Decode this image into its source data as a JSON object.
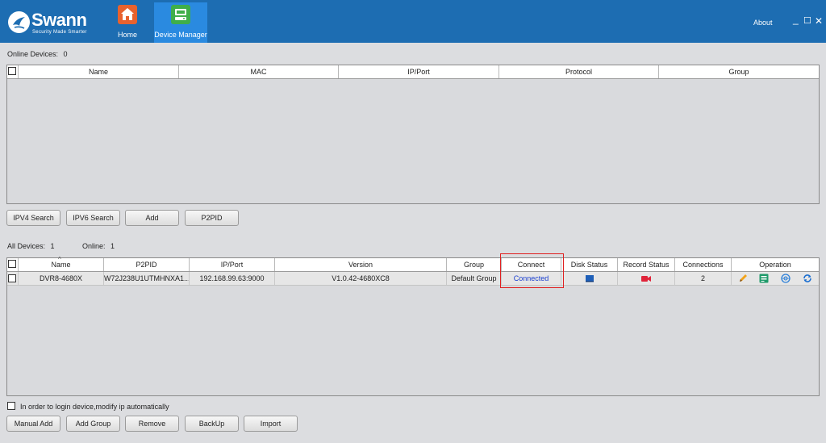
{
  "app": {
    "logo_text": "Swann",
    "logo_tagline": "Security Made Smarter",
    "nav": [
      {
        "label": "Home",
        "icon": "home-icon"
      },
      {
        "label": "Device Manager",
        "icon": "device-manager-icon"
      }
    ],
    "about_label": "About",
    "window_controls": {
      "minimize": "_",
      "maximize": "☐",
      "close": "✕"
    }
  },
  "online": {
    "count_label": "Online Devices:",
    "count": "0",
    "columns": [
      "Name",
      "MAC",
      "IP/Port",
      "Protocol",
      "Group"
    ],
    "rows": []
  },
  "search_buttons": [
    "IPV4 Search",
    "IPV6 Search",
    "Add",
    "P2PID"
  ],
  "all_devices": {
    "all_label": "All Devices:",
    "all_count": "1",
    "online_label": "Online:",
    "online_count": "1",
    "columns": [
      "Name",
      "P2PID",
      "IP/Port",
      "Version",
      "Group",
      "Connect",
      "Disk Status",
      "Record Status",
      "Connections",
      "Operation"
    ],
    "rows": [
      {
        "name": "DVR8-4680X",
        "p2pid": "W72J238U1UTMHNXA1...",
        "ip_port": "192.168.99.63:9000",
        "version": "V1.0.42-4680XC8",
        "group": "Default Group",
        "connect": "Connected",
        "disk_status_icon": "disk-icon",
        "record_status_icon": "record-camera-icon",
        "connections": "2",
        "operations": [
          "edit-icon",
          "config-icon",
          "web-icon",
          "refresh-icon"
        ]
      }
    ]
  },
  "auto_modify": {
    "label": "In order to login device,modify ip automatically",
    "checked": false
  },
  "bottom_buttons": [
    "Manual Add",
    "Add Group",
    "Remove",
    "BackUp",
    "Import"
  ],
  "colors": {
    "titlebar": "#1d6db2",
    "active_nav": "#2a8ae0",
    "connected_text": "#1a3fd0",
    "highlight": "#e02020"
  }
}
